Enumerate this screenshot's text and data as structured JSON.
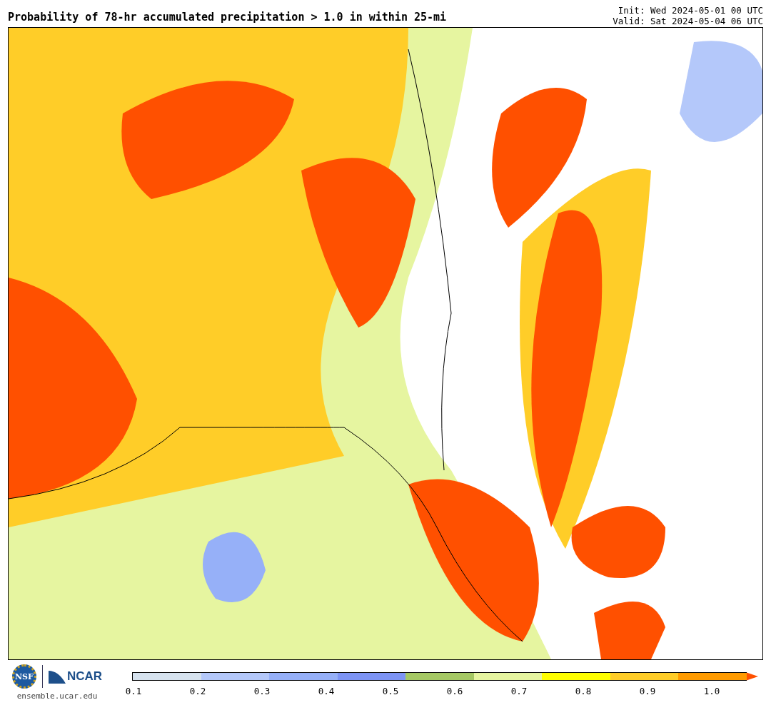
{
  "header": {
    "title": "Probability of 78-hr accumulated precipitation > 1.0 in within 25-mi",
    "init": "Init: Wed 2024-05-01 00 UTC",
    "valid": "Valid: Sat 2024-05-04 06 UTC"
  },
  "footer": {
    "nsf_logo": "NSF",
    "ncar_logo": "NCAR",
    "website": "ensemble.ucar.edu"
  },
  "colorbar": {
    "segments": [
      {
        "color": "#d6e2ee"
      },
      {
        "color": "#b4c8fa"
      },
      {
        "color": "#96b0f8"
      },
      {
        "color": "#7d94f5"
      },
      {
        "color": "#a5c864"
      },
      {
        "color": "#e6f5a0"
      },
      {
        "color": "#ffff00"
      },
      {
        "color": "#ffcd28"
      },
      {
        "color": "#ff9b00"
      }
    ],
    "extend_arrow": {
      "color": "#ff5000"
    },
    "ticks": [
      "0.1",
      "0.2",
      "0.3",
      "0.4",
      "0.5",
      "0.6",
      "0.7",
      "0.8",
      "0.9",
      "1.0"
    ]
  }
}
